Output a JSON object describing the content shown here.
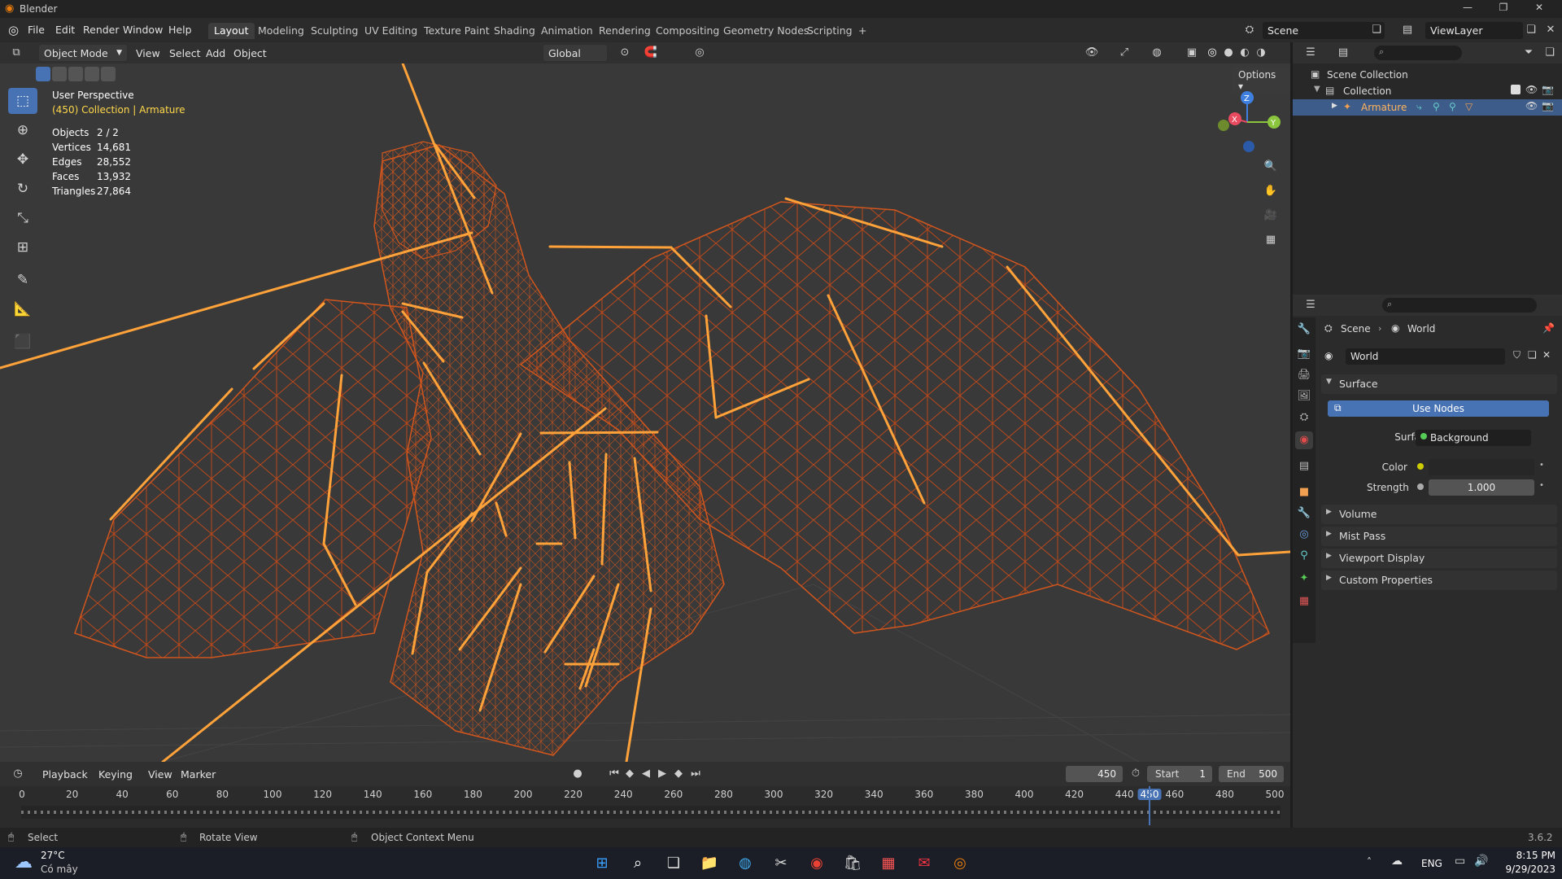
{
  "window": {
    "title": "Blender",
    "version": "3.6.2"
  },
  "menubar": {
    "menus": [
      "File",
      "Edit",
      "Render",
      "Window",
      "Help"
    ],
    "workspace_tabs": [
      "Layout",
      "Modeling",
      "Sculpting",
      "UV Editing",
      "Texture Paint",
      "Shading",
      "Animation",
      "Rendering",
      "Compositing",
      "Geometry Nodes",
      "Scripting",
      "+"
    ],
    "active_tab": "Layout",
    "scene_name": "Scene",
    "view_layer": "ViewLayer"
  },
  "viewport_header": {
    "mode": "Object Mode",
    "menus": [
      "View",
      "Select",
      "Add",
      "Object"
    ],
    "orientation": "Global",
    "options_label": "Options"
  },
  "viewport": {
    "perspective": "User Perspective",
    "collection_info": "(450) Collection | Armature",
    "stats": [
      {
        "label": "Objects",
        "value": "2 / 2"
      },
      {
        "label": "Vertices",
        "value": "14,681"
      },
      {
        "label": "Edges",
        "value": "28,552"
      },
      {
        "label": "Faces",
        "value": "13,932"
      },
      {
        "label": "Triangles",
        "value": "27,864"
      }
    ],
    "gizmo_axes": {
      "x": "X",
      "y": "Y",
      "z": "Z"
    },
    "colors": {
      "wire": "#d2561d",
      "bone": "#ffa23a",
      "background": "#393939",
      "axis_x": "#e84a5f",
      "axis_y": "#8bc43d",
      "axis_z": "#3f7fe0"
    }
  },
  "outliner": {
    "items": [
      {
        "label": "Scene Collection",
        "level": 0
      },
      {
        "label": "Collection",
        "level": 1
      },
      {
        "label": "Armature",
        "level": 2,
        "selected": true
      }
    ]
  },
  "properties": {
    "breadcrumb": [
      "Scene",
      "World"
    ],
    "world_name": "World",
    "surface_section": "Surface",
    "use_nodes_label": "Use Nodes",
    "surface_label": "Surface",
    "surface_value": "Background",
    "color_label": "Color",
    "strength_label": "Strength",
    "strength_value": "1.000",
    "collapsed_sections": [
      "Volume",
      "Mist Pass",
      "Viewport Display",
      "Custom Properties"
    ]
  },
  "timeline": {
    "menus": [
      "Playback",
      "Keying",
      "View",
      "Marker"
    ],
    "current_frame": "450",
    "start_label": "Start",
    "start_value": "1",
    "end_label": "End",
    "end_value": "500",
    "ticks": [
      "0",
      "20",
      "40",
      "60",
      "80",
      "100",
      "120",
      "140",
      "160",
      "180",
      "200",
      "220",
      "240",
      "260",
      "280",
      "300",
      "320",
      "340",
      "360",
      "380",
      "400",
      "420",
      "440",
      "450",
      "460",
      "480",
      "500"
    ]
  },
  "statusbar": {
    "hints": [
      "Select",
      "Rotate View",
      "Object Context Menu"
    ],
    "version": "3.6.2"
  },
  "taskbar": {
    "weather_temp": "27°C",
    "weather_desc": "Có mây",
    "lang": "ENG",
    "time": "8:15 PM",
    "date": "9/29/2023"
  }
}
